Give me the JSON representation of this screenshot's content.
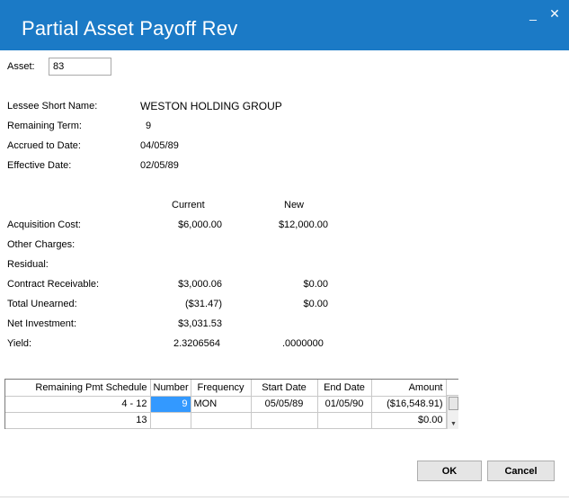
{
  "window": {
    "title": "Partial Asset Payoff Rev",
    "minimize_glyph": "_",
    "close_glyph": "✕"
  },
  "asset": {
    "label": "Asset:",
    "value": "83"
  },
  "info": {
    "lessee_label": "Lessee Short Name:",
    "lessee_value": "WESTON HOLDING GROUP",
    "term_label": "Remaining Term:",
    "term_value": "9",
    "accrued_label": "Accrued to Date:",
    "accrued_value": "04/05/89",
    "effective_label": "Effective Date:",
    "effective_value": "02/05/89"
  },
  "comparison": {
    "current_header": "Current",
    "new_header": "New",
    "rows": [
      {
        "label": "Acquisition Cost:",
        "current": "$6,000.00",
        "new": "$12,000.00"
      },
      {
        "label": "Other Charges:",
        "current": "",
        "new": ""
      },
      {
        "label": "Residual:",
        "current": "",
        "new": ""
      },
      {
        "label": "Contract Receivable:",
        "current": "$3,000.06",
        "new": "$0.00"
      },
      {
        "label": "Total Unearned:",
        "current": "($31.47)",
        "new": "$0.00"
      },
      {
        "label": "Net Investment:",
        "current": "$3,031.53",
        "new": ""
      },
      {
        "label": "Yield:",
        "current": "2.3206564",
        "new": ".0000000"
      }
    ]
  },
  "schedule": {
    "columns": [
      "Remaining Pmt Schedule",
      "Number",
      "Frequency",
      "Start Date",
      "End Date",
      "Amount"
    ],
    "rows": [
      [
        "4 - 12",
        "9",
        "MON",
        "05/05/89",
        "01/05/90",
        "($16,548.91)"
      ],
      [
        "13",
        "",
        "",
        "",
        "",
        "$0.00"
      ]
    ],
    "scroll_up_icon": "▲",
    "scroll_down_icon": "▼"
  },
  "buttons": {
    "ok": "OK",
    "cancel": "Cancel"
  },
  "colors": {
    "titlebar": "#1b7ac6",
    "selection": "#3399ff"
  }
}
